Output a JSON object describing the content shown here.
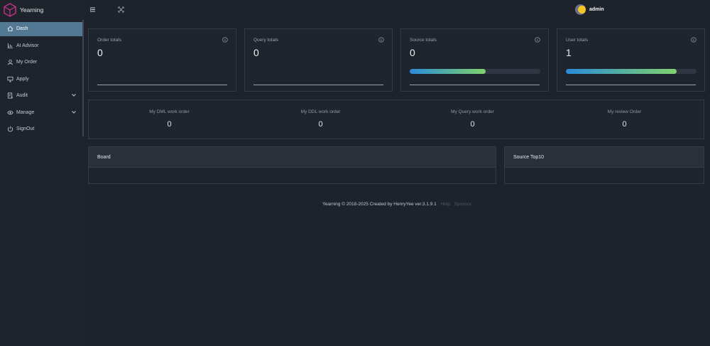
{
  "app": {
    "name": "Yearning"
  },
  "sidebar": {
    "items": [
      {
        "label": "Dash",
        "icon": "home-icon",
        "active": true
      },
      {
        "label": "AI Advisor",
        "icon": "chart-icon",
        "active": false
      },
      {
        "label": "My Order",
        "icon": "user-icon",
        "active": false
      },
      {
        "label": "Apply",
        "icon": "monitor-icon",
        "active": false
      },
      {
        "label": "Audit",
        "icon": "audit-icon",
        "active": false,
        "expandable": true
      },
      {
        "label": "Manage",
        "icon": "eye-icon",
        "active": false,
        "expandable": true
      },
      {
        "label": "SignOut",
        "icon": "signout-icon",
        "active": false
      }
    ]
  },
  "header": {
    "menu_icon": "menu-toggle-icon",
    "fullscreen_icon": "fullscreen-icon",
    "user": {
      "name": "admin"
    }
  },
  "cards": [
    {
      "title": "Order totals",
      "value": "0"
    },
    {
      "title": "Query totals",
      "value": "0"
    },
    {
      "title": "Source totals",
      "value": "0",
      "progress": 0.58
    },
    {
      "title": "User totals",
      "value": "1",
      "progress": 0.85
    }
  ],
  "stats": [
    {
      "label": "My DML work order",
      "value": "0"
    },
    {
      "label": "My DDL work order",
      "value": "0"
    },
    {
      "label": "My Query work order",
      "value": "0"
    },
    {
      "label": "My review Order",
      "value": "0"
    }
  ],
  "panels": {
    "board": {
      "title": "Board"
    },
    "source_top": {
      "title": "Source Top10"
    }
  },
  "footer": {
    "text": "Yearning © 2018-2025 Created by HenryYee ver.3.1.9.1",
    "help": "Help",
    "sponsor": "Sponsor"
  },
  "colors": {
    "background": "#1e232b",
    "active_menu": "#537894",
    "progress_start": "#2a8bd9",
    "progress_end": "#7ed36b"
  }
}
